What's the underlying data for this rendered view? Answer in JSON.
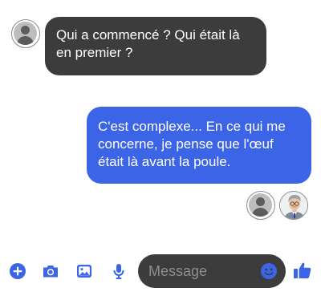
{
  "conversation": {
    "messages": [
      {
        "direction": "received",
        "text": "Qui a commencé ? Qui était là en premier ?",
        "avatar": "default-avatar-icon"
      },
      {
        "direction": "sent",
        "text": "C'est complexe... En ce qui me concerne, je pense que l'œuf était là avant la poule."
      }
    ],
    "read_receipts": [
      "default-avatar-icon",
      "portrait-avatar"
    ]
  },
  "composer": {
    "placeholder": "Message",
    "icons": [
      "plus-icon",
      "camera-icon",
      "image-icon",
      "microphone-icon",
      "emoji-icon",
      "thumbs-up-icon"
    ]
  },
  "colors": {
    "accent": "#3b64e6",
    "received_bubble": "#3c3c3c",
    "sent_bubble": "#3b64e6",
    "text_on_bubble": "#ffffff",
    "placeholder": "#8e8e8e"
  }
}
